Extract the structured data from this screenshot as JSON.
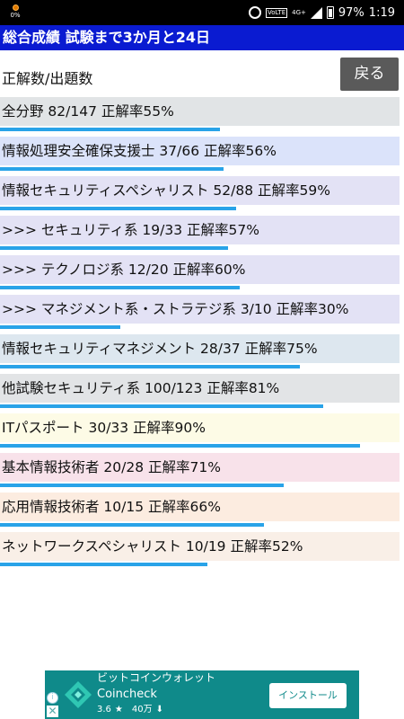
{
  "status_bar": {
    "left_percent": "0%",
    "battery": "97%",
    "time": "1:19",
    "volte": "VoLTE",
    "network": "4G+"
  },
  "title_bar": {
    "title": "総合成績  試験まで3か月と24日"
  },
  "header": {
    "label": "正解数/出題数",
    "back_label": "戻る"
  },
  "stats": [
    {
      "label": "全分野 82/147 正解率55%",
      "rate": 55,
      "bg": "#e1e4e6"
    },
    {
      "label": "情報処理安全確保支援士 37/66 正解率56%",
      "rate": 56,
      "bg": "#dbe3fa"
    },
    {
      "label": "情報セキュリティスペシャリスト 52/88 正解率59%",
      "rate": 59,
      "bg": "#e3e2f5"
    },
    {
      "label": " >>> セキュリティ系 19/33 正解率57%",
      "rate": 57,
      "bg": "#e3e2f5"
    },
    {
      "label": " >>> テクノロジ系 12/20 正解率60%",
      "rate": 60,
      "bg": "#e3e2f5"
    },
    {
      "label": " >>> マネジメント系・ストラテジ系 3/10 正解率30%",
      "rate": 30,
      "bg": "#e3e2f5"
    },
    {
      "label": "情報セキュリティマネジメント 28/37 正解率75%",
      "rate": 75,
      "bg": "#dde7ef"
    },
    {
      "label": "他試験セキュリティ系 100/123 正解率81%",
      "rate": 81,
      "bg": "#e2e4e6"
    },
    {
      "label": "ITパスポート 30/33 正解率90%",
      "rate": 90,
      "bg": "#fdfbe6"
    },
    {
      "label": "基本情報技術者 20/28 正解率71%",
      "rate": 71,
      "bg": "#f8e2ea"
    },
    {
      "label": "応用情報技術者 10/15 正解率66%",
      "rate": 66,
      "bg": "#fcece0"
    },
    {
      "label": "ネットワークスペシャリスト 10/19 正解率52%",
      "rate": 52,
      "bg": "#f9efe7"
    }
  ],
  "ad": {
    "title": "ビットコインウォレット",
    "brand": "Coincheck",
    "rating": "3.6",
    "downloads": "40万",
    "install_label": "インストール",
    "info_glyph": "i",
    "close_glyph": "✕",
    "star_glyph": "★",
    "download_glyph": "⬇"
  },
  "colors": {
    "title_bar": "#0a1bd1",
    "progress": "#29a3e8",
    "back_button": "#5a5a5a",
    "ad_background": "#0f8a8a"
  }
}
